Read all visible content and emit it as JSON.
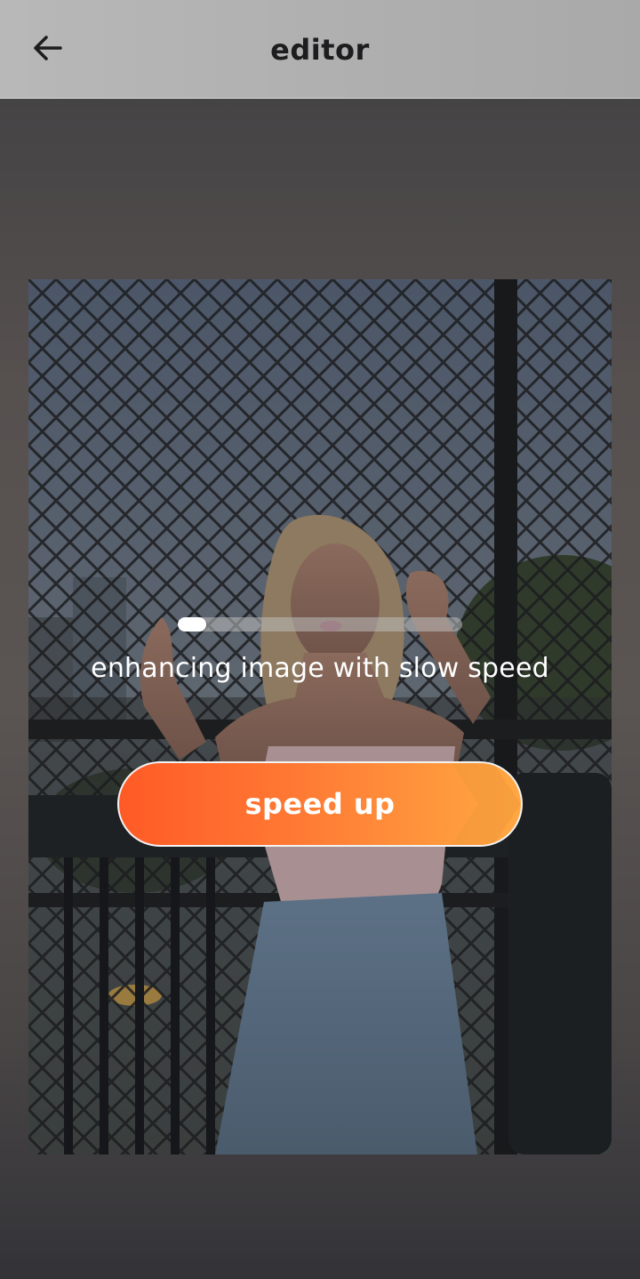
{
  "header": {
    "title": "editor",
    "back_icon": "arrow-left-icon"
  },
  "photo": {
    "subject": "woman-standing-by-chain-link-fence"
  },
  "progress": {
    "fraction": 0.1,
    "status_text": "enhancing image with slow speed"
  },
  "speed_button": {
    "label": "speed up"
  },
  "colors": {
    "accent_start": "#ff5a26",
    "accent_end": "#ffa842",
    "header_bg": "#b0b0b0"
  }
}
